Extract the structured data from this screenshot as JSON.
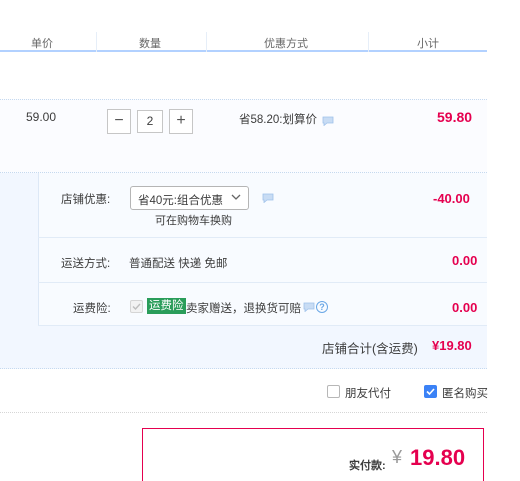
{
  "header": {
    "col_price": "单价",
    "col_qty": "数量",
    "col_discount": "优惠方式",
    "col_subtotal": "小计"
  },
  "item": {
    "price": "59.00",
    "quantity": "2",
    "discount_text": "省58.20:划算价",
    "subtotal": "59.80",
    "minus_symbol": "−",
    "plus_symbol": "+"
  },
  "shop": {
    "promo_label": "店铺优惠:",
    "promo_selected": "省40元:组合优惠",
    "promo_hint": "可在购物车换购",
    "promo_amount": "-40.00",
    "shipping_label": "运送方式:",
    "shipping_value": "普通配送 快递 免邮",
    "shipping_amount": "0.00",
    "insurance_label": "运费险:",
    "insurance_badge": "运费险",
    "insurance_text": "卖家赠送，退换货可赔",
    "insurance_amount": "0.00",
    "help_glyph": "?",
    "total_label": "店铺合计(含运费)",
    "total_value": "¥19.80"
  },
  "options": {
    "friend_pay": "朋友代付",
    "friend_pay_checked": false,
    "anonymous": "匿名购买",
    "anonymous_checked": true
  },
  "payment": {
    "label": "实付款:",
    "currency": "¥",
    "amount": "19.80"
  },
  "colors": {
    "accent_red": "#e5004f",
    "header_line": "#b2d1ff",
    "badge_green": "#2a9d5a",
    "checkbox_blue": "#3b82f6"
  },
  "icons": {
    "chat": "chat-bubble-icon",
    "dropdown": "chevron-down-icon",
    "help": "help-circle-icon",
    "check": "checkmark-icon"
  }
}
